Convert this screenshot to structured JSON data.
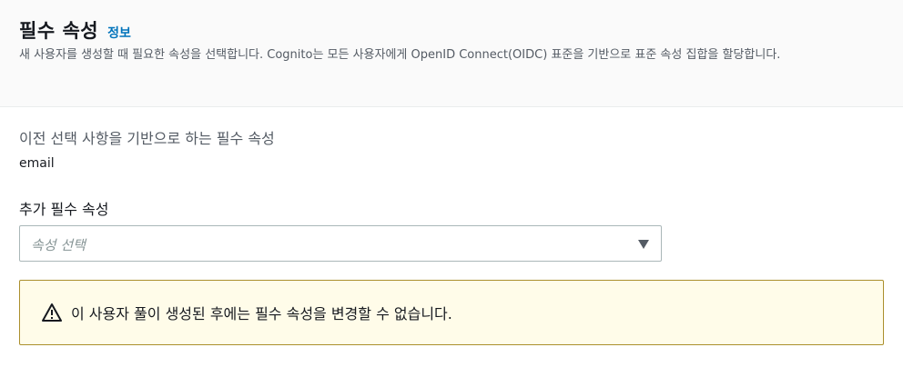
{
  "header": {
    "title": "필수 속성",
    "info_link": "정보",
    "description": "새 사용자를 생성할 때 필요한 속성을 선택합니다. Cognito는 모든 사용자에게 OpenID Connect(OIDC) 표준을 기반으로 표준 속성 집합을 할당합니다."
  },
  "prior_required": {
    "label": "이전 선택 사항을 기반으로 하는 필수 속성",
    "value": "email"
  },
  "additional_required": {
    "label": "추가 필수 속성",
    "placeholder": "속성 선택"
  },
  "alert": {
    "icon": "warning-icon",
    "message": "이 사용자 풀이 생성된 후에는 필수 속성을 변경할 수 없습니다."
  },
  "colors": {
    "link": "#0073bb",
    "alert_bg": "#fffce9",
    "alert_border": "#ab8f2c"
  }
}
